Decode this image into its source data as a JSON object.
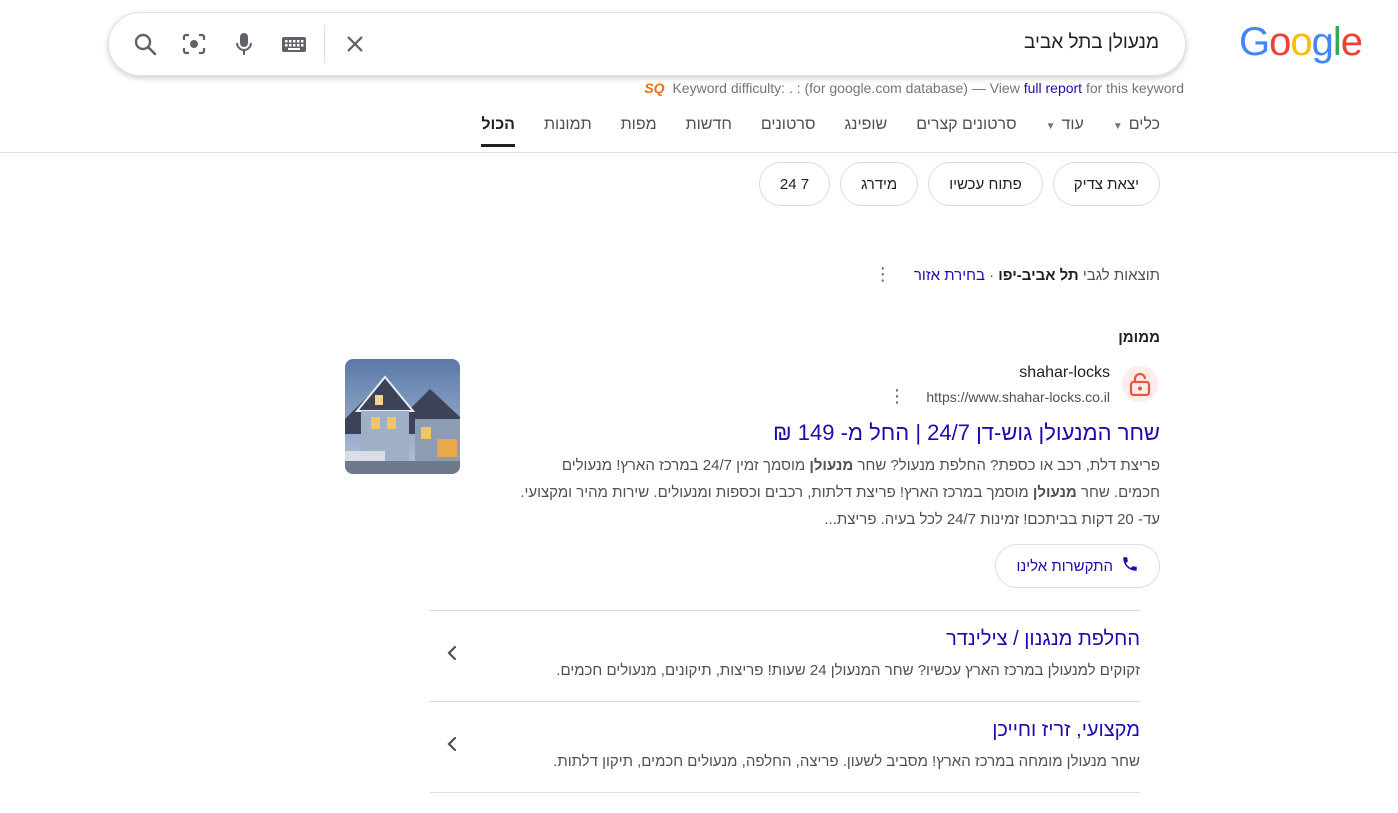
{
  "logo": {
    "text": "Google",
    "colors": [
      "#4285F4",
      "#EA4335",
      "#FBBC05",
      "#4285F4",
      "#34A853",
      "#EA4335"
    ]
  },
  "search": {
    "query": "מנעולן בתל אביב"
  },
  "keyword_difficulty": {
    "logo": "SQ",
    "label": "Keyword difficulty:",
    "value": ". :",
    "db_text": "(for google.com database) — View",
    "link": "full report",
    "suffix": "for this keyword"
  },
  "tabs": [
    {
      "label": "הכול",
      "active": true
    },
    {
      "label": "תמונות"
    },
    {
      "label": "מפות"
    },
    {
      "label": "חדשות"
    },
    {
      "label": "סרטונים"
    },
    {
      "label": "שופינג"
    },
    {
      "label": "סרטונים קצרים"
    },
    {
      "label": "עוד",
      "dropdown": true
    },
    {
      "label": "כלים",
      "dropdown": true
    }
  ],
  "chips": [
    "יצאת צדיק",
    "פתוח עכשיו",
    "מידרג",
    "24 7"
  ],
  "location": {
    "prefix": "תוצאות לגבי",
    "place": "תל אביב-יפו",
    "separator": "·",
    "choose": "בחירת אזור"
  },
  "ad": {
    "sponsored_label": "ממומן",
    "site_name": "shahar-locks",
    "url": "https://www.shahar-locks.co.il",
    "title": "שחר המנעולן גוש-דן 24/7 | החל מ- 149 ₪",
    "desc": [
      "פריצת דלת, רכב או כספת? החלפת מנעול? שחר ",
      "מנעולן",
      " מוסמך זמין 24/7 במרכז הארץ! מנעולים חכמים. שחר ",
      "מנעולן",
      " מוסמך במרכז הארץ! פריצת דלתות, רכבים וכספות ומנעולים. שירות מהיר ומקצועי. עד- 20 דקות בביתכם! זמינות 24/7 לכל בעיה. פריצת..."
    ],
    "call_label": "התקשרות אלינו"
  },
  "sitelinks": [
    {
      "title": "החלפת מנגנון / צילינדר",
      "desc": "זקוקים למנעולן במרכז הארץ עכשיו? שחר המנעולן 24 שעות! פריצות, תיקונים, מנעולים חכמים."
    },
    {
      "title": "מקצועי, זריז וחייכן",
      "desc": "שחר מנעולן מומחה במרכז הארץ! מסביב לשעון. פריצה, החלפה, מנעולים חכמים, תיקון דלתות."
    }
  ]
}
